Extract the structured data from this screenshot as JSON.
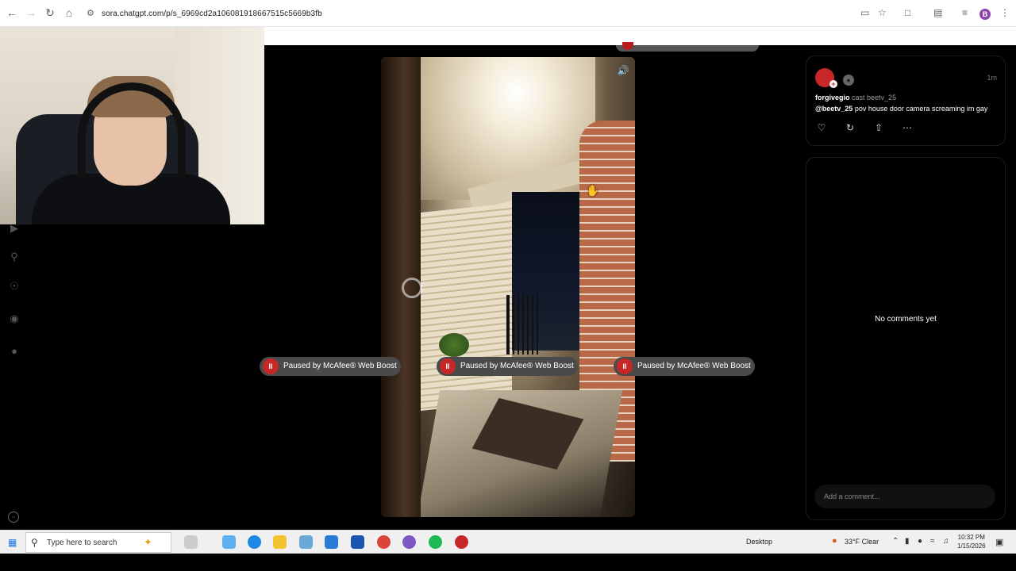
{
  "browser": {
    "url": "sora.chatgpt.com/p/s_6969cd2a106081918667515c5669b3fb",
    "profile_initial": "B"
  },
  "sidebar": {
    "icons": [
      "home-icon",
      "search-icon",
      "trophy-icon",
      "bell-icon",
      "profile-icon"
    ],
    "bottom_icon": "minus-circle-icon"
  },
  "video": {
    "mute_icon": "speaker-icon"
  },
  "mcafee": {
    "pause_label": "Paused by McAfee® Web Boost",
    "pause_glyph": "II"
  },
  "post": {
    "username": "forgivegio",
    "cast_text": "cast beetv_25",
    "mention": "@beetv_25",
    "caption": "pov house door camera screaming im gay",
    "time": "1m",
    "actions": [
      "heart-icon",
      "remix-icon",
      "share-icon",
      "more-icon"
    ]
  },
  "comments": {
    "empty_text": "No comments yet",
    "placeholder": "Add a comment..."
  },
  "taskbar": {
    "search_placeholder": "Type here to search",
    "desktop_label": "Desktop",
    "weather": "33°F  Clear",
    "time": "10:32 PM",
    "date": "1/15/2026"
  }
}
